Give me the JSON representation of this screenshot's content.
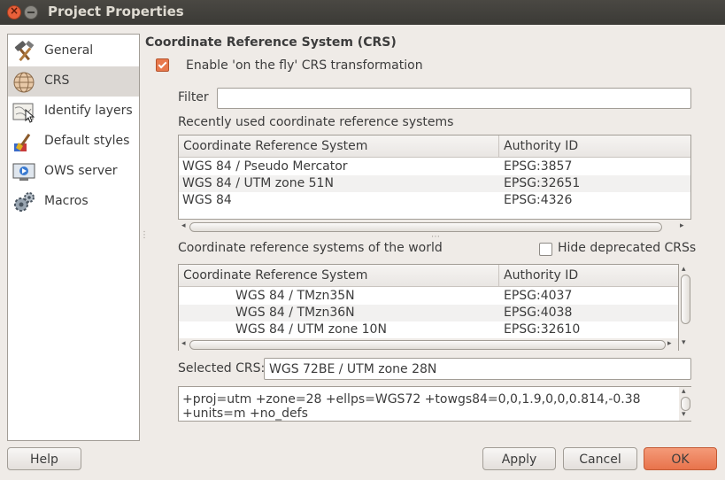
{
  "window": {
    "title": "Project Properties"
  },
  "sidebar": {
    "items": [
      {
        "label": "General",
        "icon": "hammer-icon"
      },
      {
        "label": "CRS",
        "icon": "globe-icon"
      },
      {
        "label": "Identify layers",
        "icon": "map-cursor-icon"
      },
      {
        "label": "Default styles",
        "icon": "paintbrush-icon"
      },
      {
        "label": "OWS server",
        "icon": "monitor-play-icon"
      },
      {
        "label": "Macros",
        "icon": "gears-icon"
      }
    ],
    "selected": "CRS"
  },
  "crs": {
    "section_title": "Coordinate Reference System (CRS)",
    "enable_otf_label": "Enable 'on the fly' CRS transformation",
    "enable_otf_checked": true,
    "filter_label": "Filter",
    "filter_value": "",
    "recent_label": "Recently used coordinate reference systems",
    "recent_table": {
      "columns": [
        "Coordinate Reference System",
        "Authority ID"
      ],
      "rows": [
        [
          "WGS 84 / Pseudo Mercator",
          "EPSG:3857"
        ],
        [
          "WGS 84 / UTM zone 51N",
          "EPSG:32651"
        ],
        [
          "WGS 84",
          "EPSG:4326"
        ]
      ]
    },
    "world_label": "Coordinate reference systems of the world",
    "hide_deprecated_label": "Hide deprecated CRSs",
    "hide_deprecated_checked": false,
    "world_table": {
      "columns": [
        "Coordinate Reference System",
        "Authority ID"
      ],
      "rows": [
        [
          "WGS 84 / TMzn35N",
          "EPSG:4037"
        ],
        [
          "WGS 84 / TMzn36N",
          "EPSG:4038"
        ],
        [
          "WGS 84 / UTM zone 10N",
          "EPSG:32610"
        ]
      ]
    },
    "selected_label": "Selected CRS:",
    "selected_value": "WGS 72BE / UTM zone 28N",
    "proj_string": "+proj=utm +zone=28 +ellps=WGS72 +towgs84=0,0,1.9,0,0,0.814,-0.38 +units=m +no_defs"
  },
  "buttons": {
    "help": "Help",
    "apply": "Apply",
    "cancel": "Cancel",
    "ok": "OK"
  },
  "colors": {
    "accent": "#e8734c",
    "selection": "#dcd8d4",
    "titlebar": "#3b3a36"
  }
}
